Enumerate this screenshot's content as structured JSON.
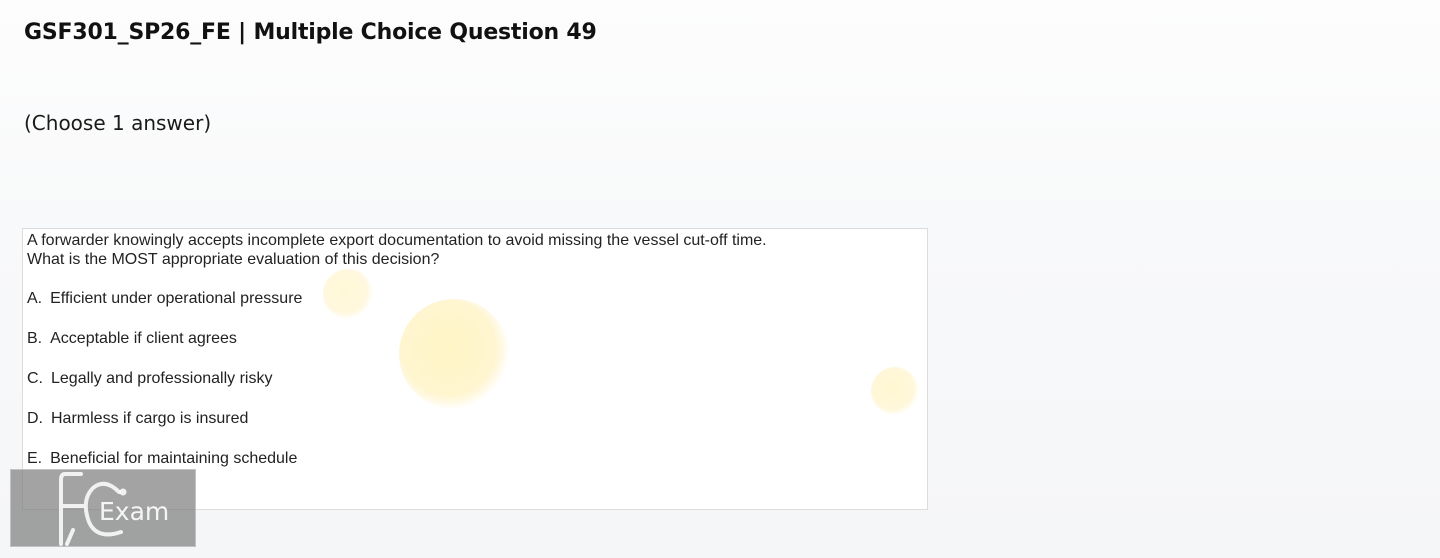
{
  "page": {
    "title": "GSF301_SP26_FE | Multiple Choice Question 49",
    "instruction": "(Choose 1 answer)"
  },
  "question": {
    "stem_line1": "A forwarder knowingly accepts incomplete export documentation to avoid missing the vessel cut-off time.",
    "stem_line2": "What is the MOST appropriate evaluation of this decision?",
    "options": [
      {
        "letter": "A.",
        "text": "Efficient under operational pressure"
      },
      {
        "letter": "B.",
        "text": "Acceptable if client agrees"
      },
      {
        "letter": "C.",
        "text": "Legally and professionally risky"
      },
      {
        "letter": "D.",
        "text": "Harmless if cargo is insured"
      },
      {
        "letter": "E.",
        "text": "Beneficial for maintaining schedule"
      }
    ]
  },
  "watermark": {
    "logo_text": "Exam",
    "logo_icon": "fc-logo-icon"
  }
}
